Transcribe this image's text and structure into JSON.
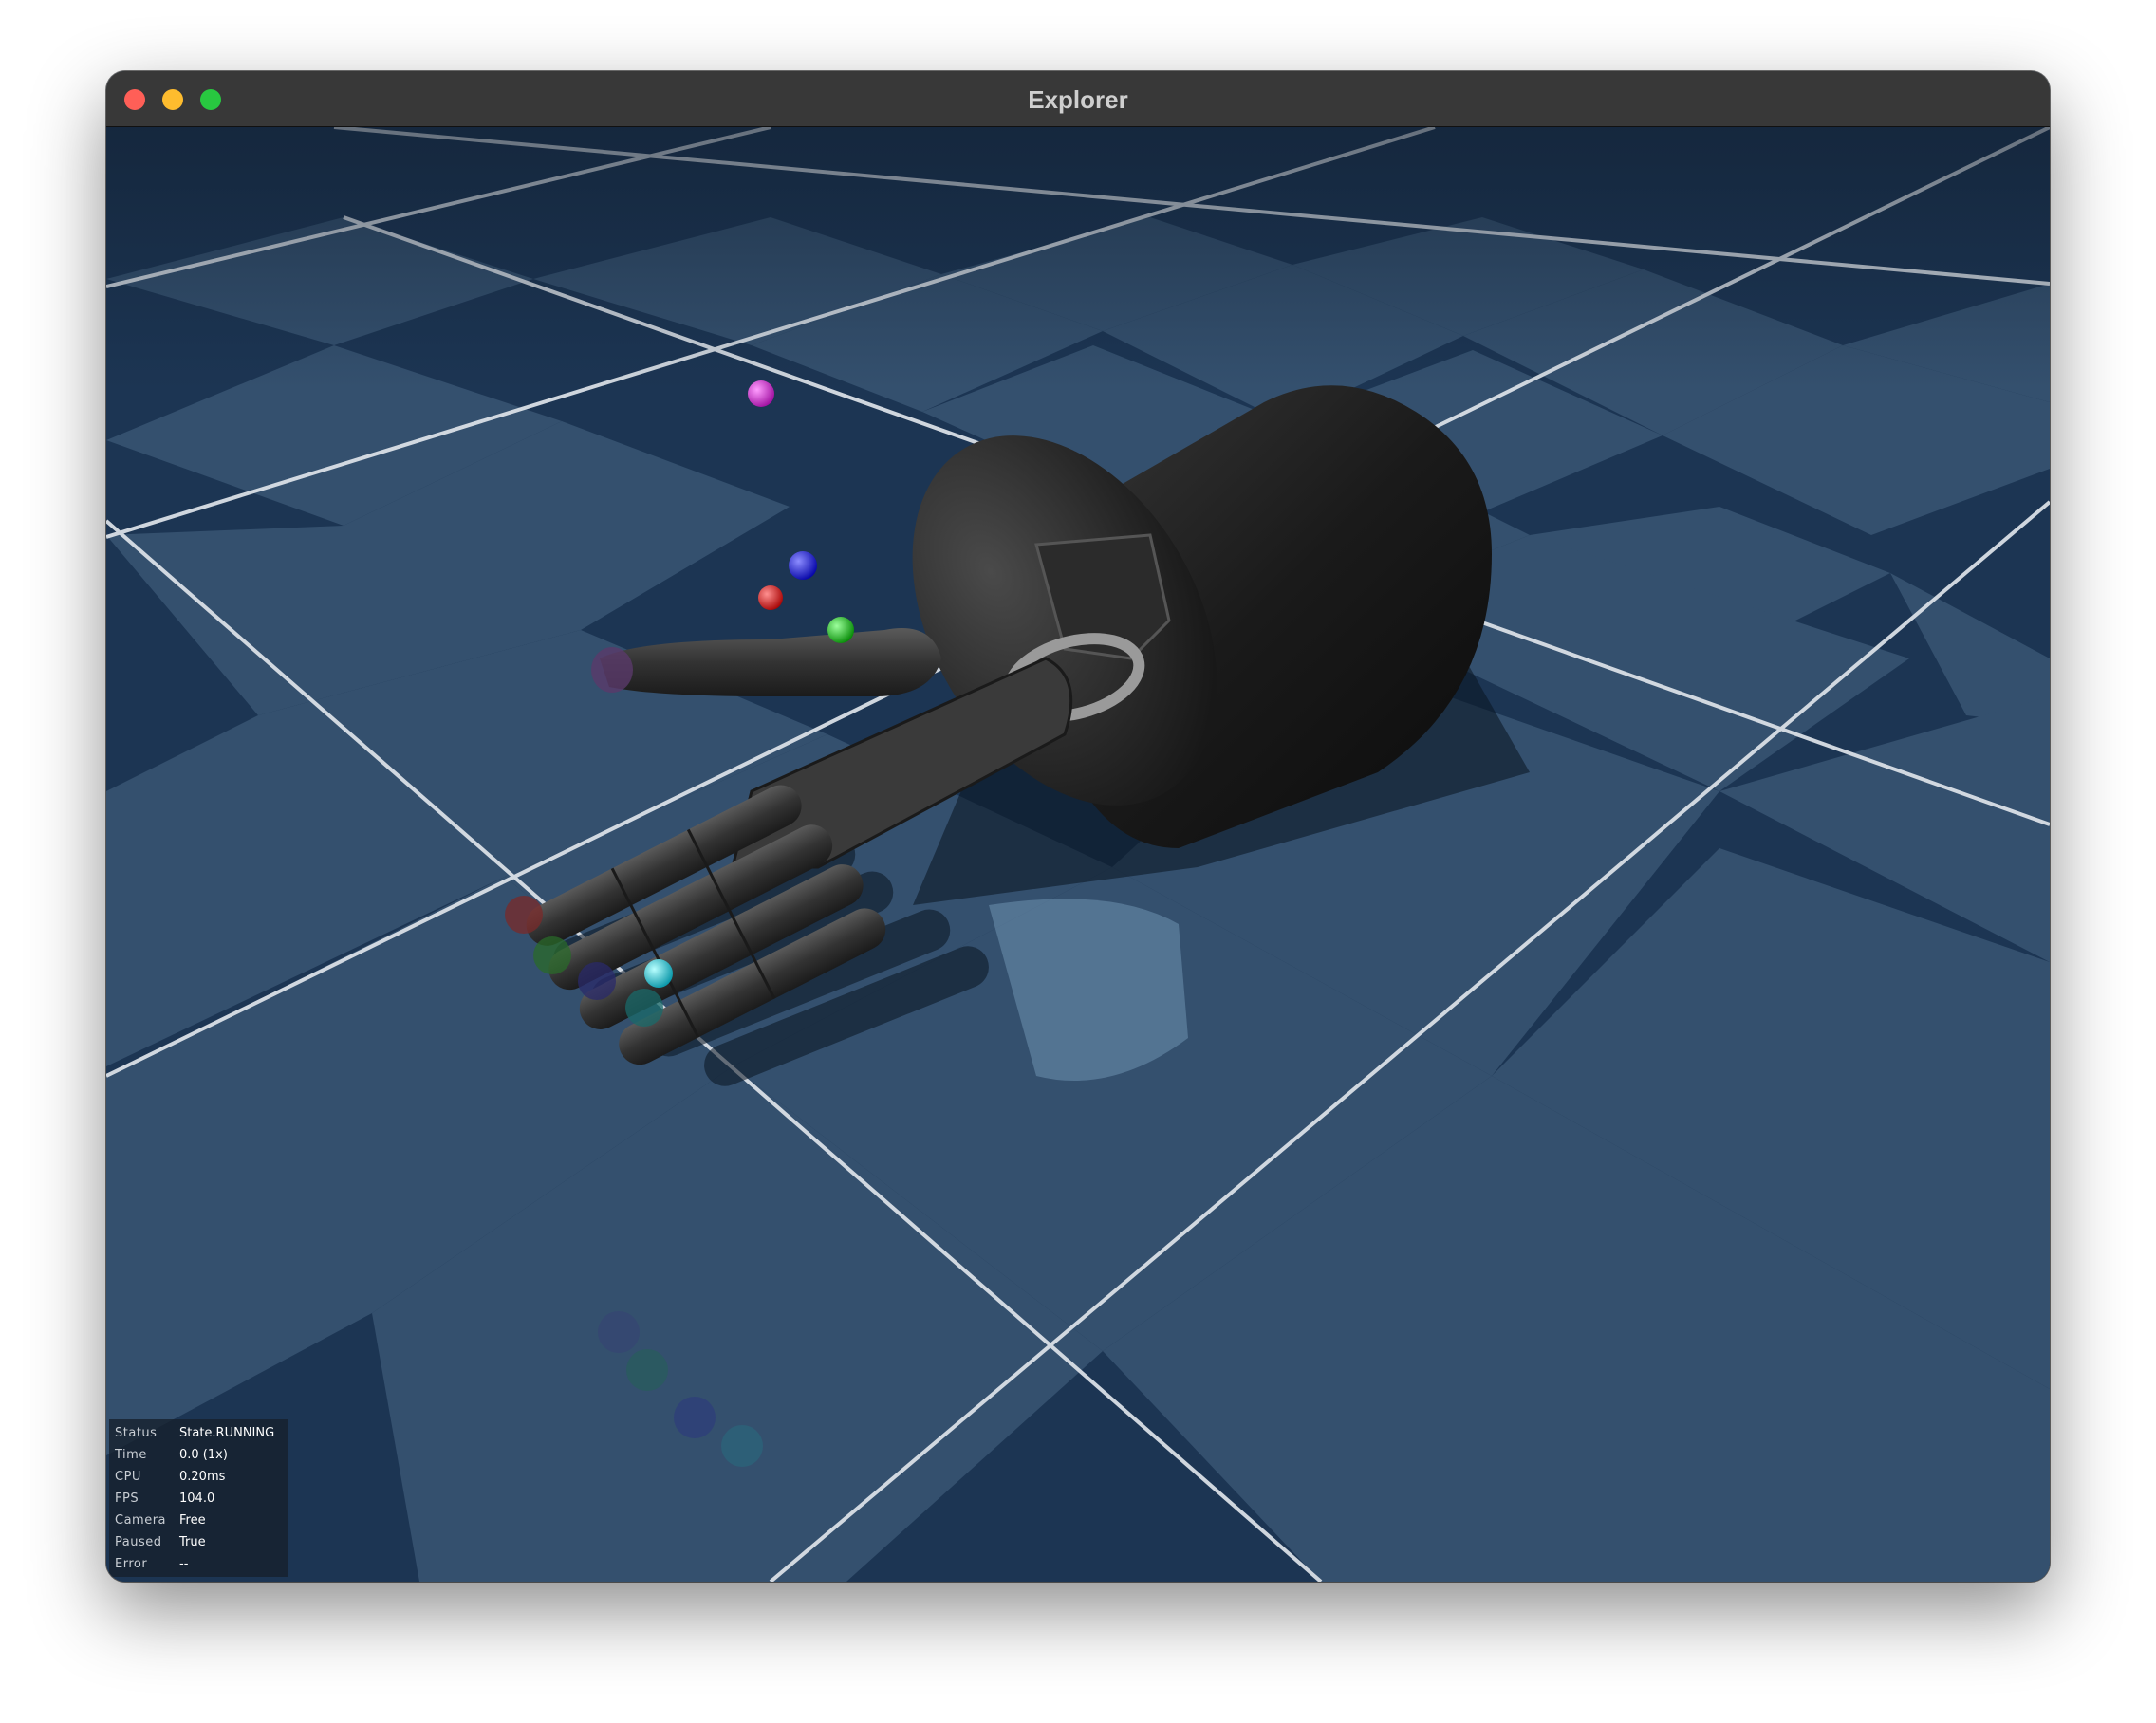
{
  "window": {
    "title": "Explorer",
    "controls": [
      "close",
      "minimize",
      "zoom"
    ]
  },
  "scene": {
    "floor_colors": {
      "light": "#34506e",
      "dark": "#1c3553",
      "lines": "#dfe4ea"
    },
    "model": "robot-hand",
    "markers": [
      {
        "name": "magenta-marker",
        "color": "#d52ad5"
      },
      {
        "name": "blue-marker",
        "color": "#1010e0"
      },
      {
        "name": "red-marker",
        "color": "#e01010"
      },
      {
        "name": "green-marker",
        "color": "#10c010"
      },
      {
        "name": "cyan-marker",
        "color": "#10d8e0"
      }
    ]
  },
  "info_panel": {
    "rows": [
      {
        "key": "Status",
        "value": "State.RUNNING"
      },
      {
        "key": "Time",
        "value": "0.0 (1x)"
      },
      {
        "key": "CPU",
        "value": "0.20ms"
      },
      {
        "key": "FPS",
        "value": "104.0"
      },
      {
        "key": "Camera",
        "value": "Free"
      },
      {
        "key": "Paused",
        "value": "True"
      },
      {
        "key": "Error",
        "value": "--"
      }
    ]
  }
}
